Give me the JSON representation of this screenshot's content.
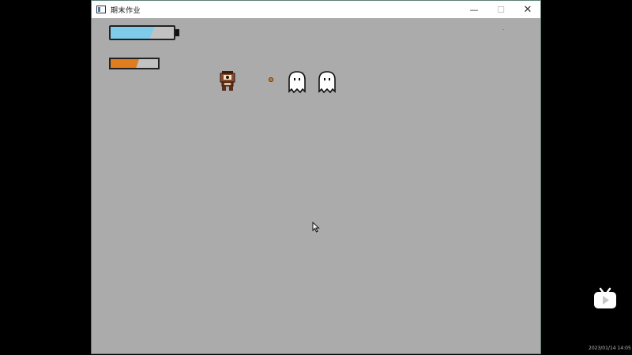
{
  "window": {
    "title": "期末作业",
    "buttons": {
      "minimize": "—",
      "maximize": "☐",
      "close": "✕"
    },
    "background_color": "#ababab"
  },
  "hud": {
    "health_level": 0.7,
    "health_color": "#7ecbea",
    "energy_level": 0.6,
    "energy_color": "#e07d1f"
  },
  "sprites": {
    "player": "robot-player",
    "bullet": "bullet",
    "enemies": [
      "ghost",
      "ghost"
    ]
  },
  "overlay": {
    "logo": "bilibili-play-icon",
    "timestamp": "2023/01/14 14:05"
  }
}
